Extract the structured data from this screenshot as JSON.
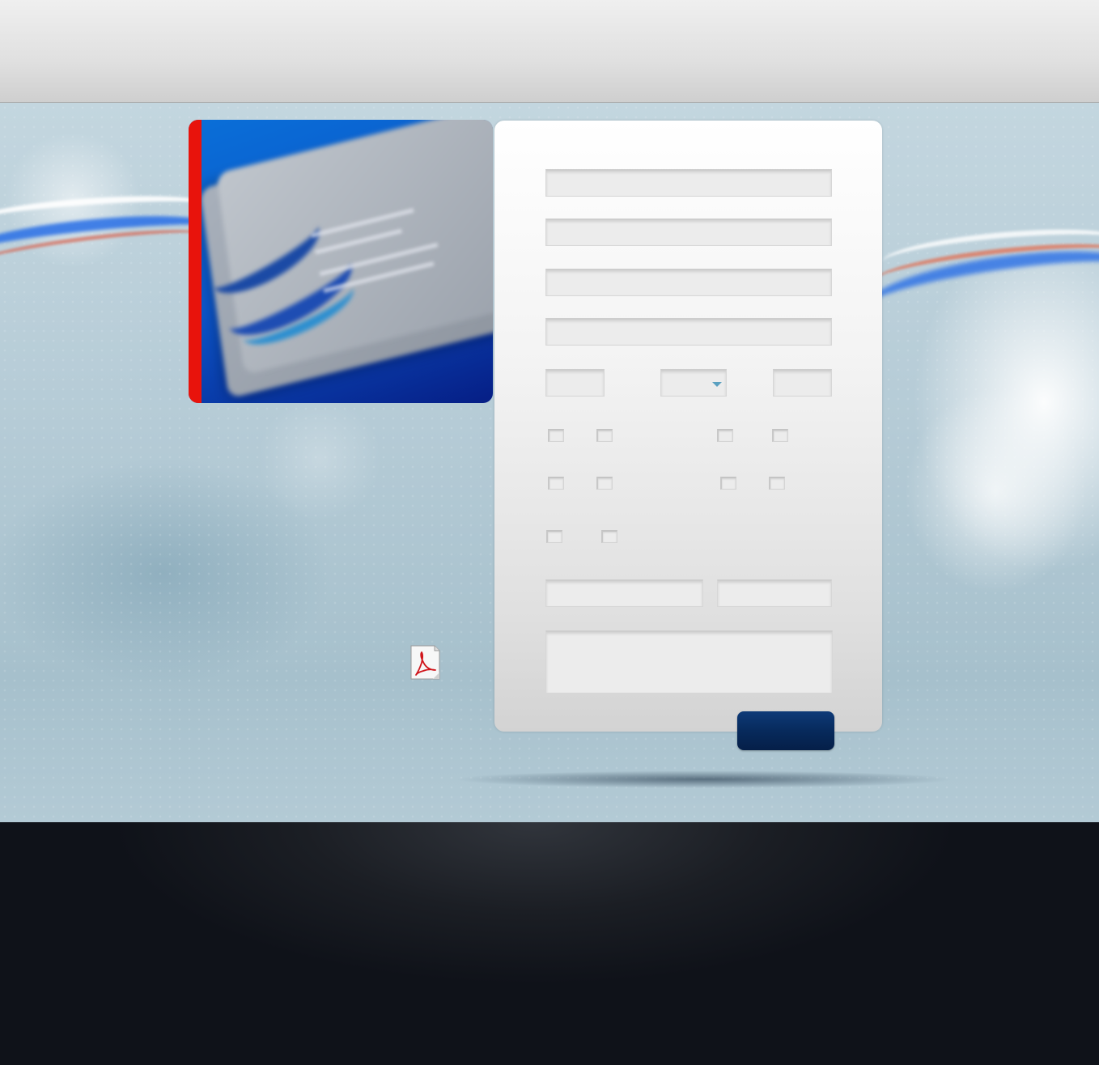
{
  "form": {
    "field_1": "",
    "field_2": "",
    "field_3": "",
    "field_4": "",
    "field_5": "",
    "dropdown_value": "",
    "field_6": "",
    "field_7": "",
    "field_8": "",
    "message": "",
    "submit_label": ""
  },
  "icons": {
    "pdf": "pdf-document-icon",
    "dropdown": "chevron-down-icon"
  },
  "colors": {
    "accent_red": "#e8130c",
    "button_navy": "#072a5c",
    "footer_dark": "#0f1219"
  }
}
